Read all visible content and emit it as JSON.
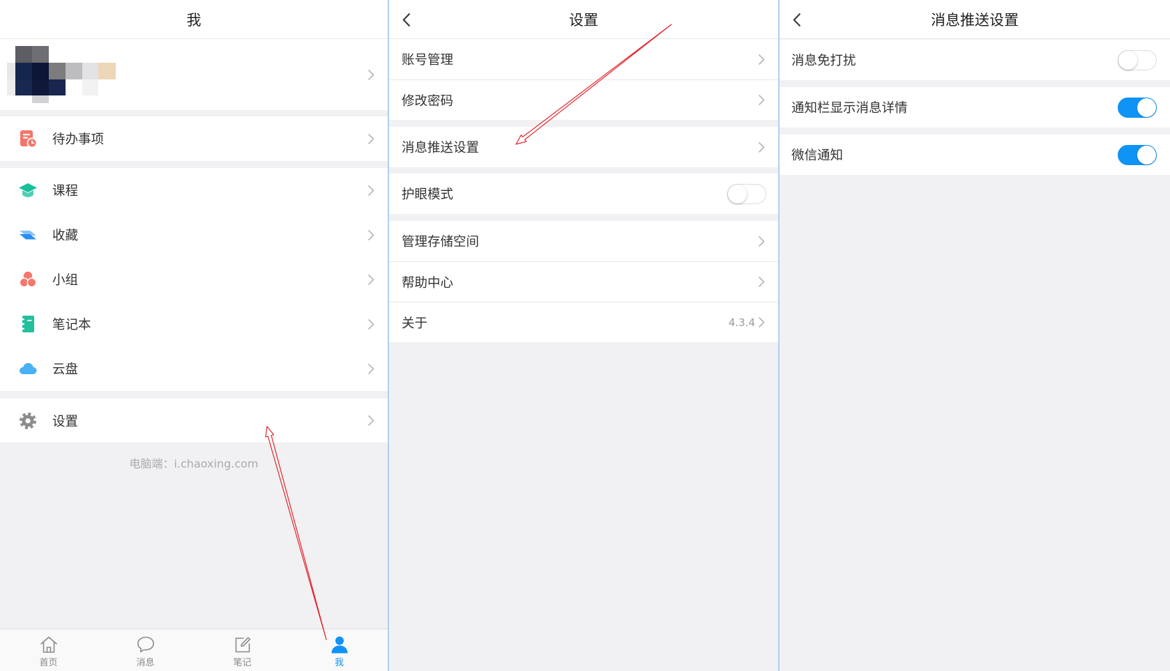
{
  "theme": {
    "background": "#f1f1f3",
    "accent": "#0f93f5",
    "divider": "#b4cdef",
    "annotation": "#e2262d"
  },
  "me_panel": {
    "title": "我",
    "items": [
      {
        "label": "待办事项",
        "icon": "todo-icon",
        "color": "#f3766b"
      },
      {
        "label": "课程",
        "icon": "course-icon",
        "color": "#17bf9b"
      },
      {
        "label": "收藏",
        "icon": "favorites-icon",
        "color": "#2a8ef4"
      },
      {
        "label": "小组",
        "icon": "group-icon",
        "color": "#f4786c"
      },
      {
        "label": "笔记本",
        "icon": "notebook-icon",
        "color": "#22c09c"
      },
      {
        "label": "云盘",
        "icon": "cloud-drive-icon",
        "color": "#47b1f3"
      },
      {
        "label": "设置",
        "icon": "settings-icon",
        "color": "#8c8c8e"
      }
    ],
    "footer_text": "电脑端：i.chaoxing.com",
    "tabs": [
      {
        "label": "首页",
        "icon": "home-icon",
        "active": false
      },
      {
        "label": "消息",
        "icon": "message-icon",
        "active": false
      },
      {
        "label": "笔记",
        "icon": "note-icon",
        "active": false
      },
      {
        "label": "我",
        "icon": "profile-icon",
        "active": true
      }
    ]
  },
  "settings_panel": {
    "title": "设置",
    "items": [
      {
        "label": "账号管理"
      },
      {
        "label": "修改密码"
      },
      {
        "label": "消息推送设置"
      },
      {
        "label": "护眼模式",
        "toggle_on": false
      },
      {
        "label": "管理存储空间"
      },
      {
        "label": "帮助中心"
      },
      {
        "label": "关于",
        "value": "4.3.4"
      }
    ]
  },
  "push_settings_panel": {
    "title": "消息推送设置",
    "items": [
      {
        "label": "消息免打扰",
        "toggle_on": false
      },
      {
        "label": "通知栏显示消息详情",
        "toggle_on": true
      },
      {
        "label": "微信通知",
        "toggle_on": true
      }
    ]
  }
}
